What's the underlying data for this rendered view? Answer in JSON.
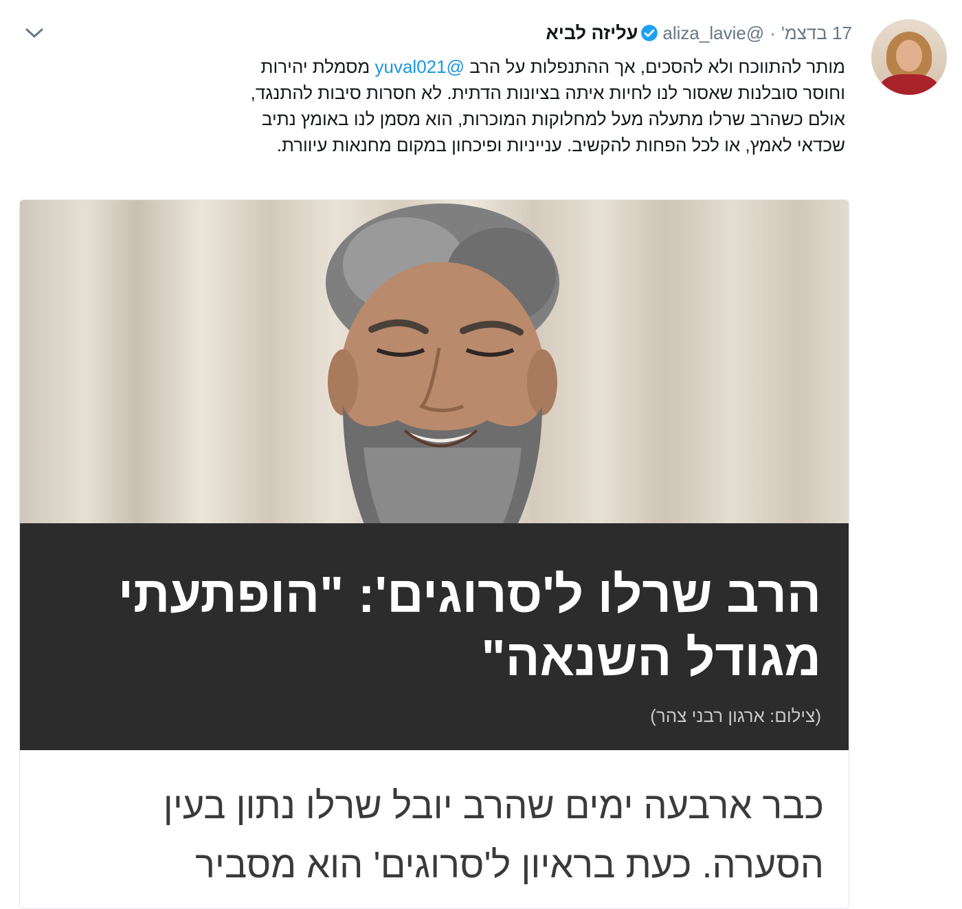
{
  "tweet": {
    "display_name": "עליזה לביא",
    "handle": "@aliza_lavie",
    "separator": "·",
    "time": "17 בדצמ'",
    "verified_icon": "verified-badge-icon",
    "menu_icon": "chevron-down-icon",
    "text_lines": [
      {
        "before": "מותר להתווכח ולא להסכים, אך ההתנפלות על הרב ",
        "mention": "@yuval021",
        "after": " מסמלת יהירות"
      },
      {
        "before": "וחוסר סובלנות שאסור לנו לחיות איתה בציונות הדתית. לא חסרות סיבות להתנגד,",
        "mention": "",
        "after": ""
      },
      {
        "before": "אולם כשהרב שרלו מתעלה מעל למחלוקות המוכרות, הוא מסמן לנו באומץ נתיב",
        "mention": "",
        "after": ""
      },
      {
        "before": "שכדאי לאמץ, או לכל הפחות להקשיב. ענייניות ופיכחון במקום מחנאות עיוורת.",
        "mention": "",
        "after": ""
      }
    ]
  },
  "card": {
    "headline_lines": [
      "הרב שרלו ל'סרוגים': \"הופתעתי",
      "מגודל השנאה\""
    ],
    "credit": "(צילום: ארגון רבני צהר)",
    "article_lines": [
      "כבר ארבעה ימים שהרב יובל שרלו נתון בעין",
      "הסערה. כעת בראיון ל'סרוגים' הוא מסביר"
    ]
  },
  "colors": {
    "accent": "#1b95e0",
    "text": "#14171a",
    "muted": "#657786",
    "headline_band": "#2c2c2c"
  }
}
